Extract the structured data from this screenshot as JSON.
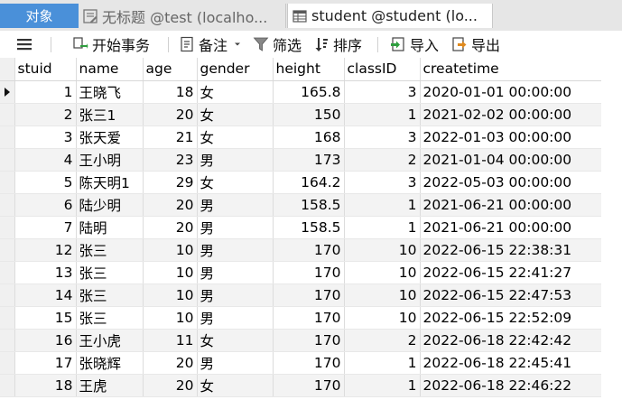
{
  "tabs": [
    {
      "label": "对象",
      "icon": "none"
    },
    {
      "label": "无标题 @test (localho...",
      "icon": "query-icon"
    },
    {
      "label": "student @student (lo...",
      "icon": "table-icon"
    }
  ],
  "toolbar": {
    "menu_icon": "hamburger-icon",
    "begin_transaction": "开始事务",
    "note": "备注",
    "filter": "筛选",
    "sort": "排序",
    "import": "导入",
    "export": "导出"
  },
  "table": {
    "columns": [
      "stuid",
      "name",
      "age",
      "gender",
      "height",
      "classID",
      "createtime"
    ],
    "rows": [
      [
        "1",
        "王晓飞",
        "18",
        "女",
        "165.8",
        "3",
        "2020-01-01 00:00:00"
      ],
      [
        "2",
        "张三1",
        "20",
        "女",
        "150",
        "1",
        "2021-02-02 00:00:00"
      ],
      [
        "3",
        "张天爱",
        "21",
        "女",
        "168",
        "3",
        "2022-01-03 00:00:00"
      ],
      [
        "4",
        "王小明",
        "23",
        "男",
        "173",
        "2",
        "2021-01-04 00:00:00"
      ],
      [
        "5",
        "陈天明1",
        "29",
        "女",
        "164.2",
        "3",
        "2022-05-03 00:00:00"
      ],
      [
        "6",
        "陆少明",
        "20",
        "男",
        "158.5",
        "1",
        "2021-06-21 00:00:00"
      ],
      [
        "7",
        "陆明",
        "20",
        "男",
        "158.5",
        "1",
        "2021-06-21 00:00:00"
      ],
      [
        "12",
        "张三",
        "10",
        "男",
        "170",
        "10",
        "2022-06-15 22:38:31"
      ],
      [
        "13",
        "张三",
        "10",
        "男",
        "170",
        "10",
        "2022-06-15 22:41:27"
      ],
      [
        "14",
        "张三",
        "10",
        "男",
        "170",
        "10",
        "2022-06-15 22:47:53"
      ],
      [
        "15",
        "张三",
        "10",
        "男",
        "170",
        "10",
        "2022-06-15 22:52:09"
      ],
      [
        "16",
        "王小虎",
        "11",
        "女",
        "170",
        "2",
        "2022-06-18 22:42:42"
      ],
      [
        "17",
        "张晓辉",
        "20",
        "男",
        "170",
        "1",
        "2022-06-18 22:45:41"
      ],
      [
        "18",
        "王虎",
        "20",
        "女",
        "170",
        "1",
        "2022-06-18 22:46:22"
      ]
    ],
    "selected_row": 0
  }
}
